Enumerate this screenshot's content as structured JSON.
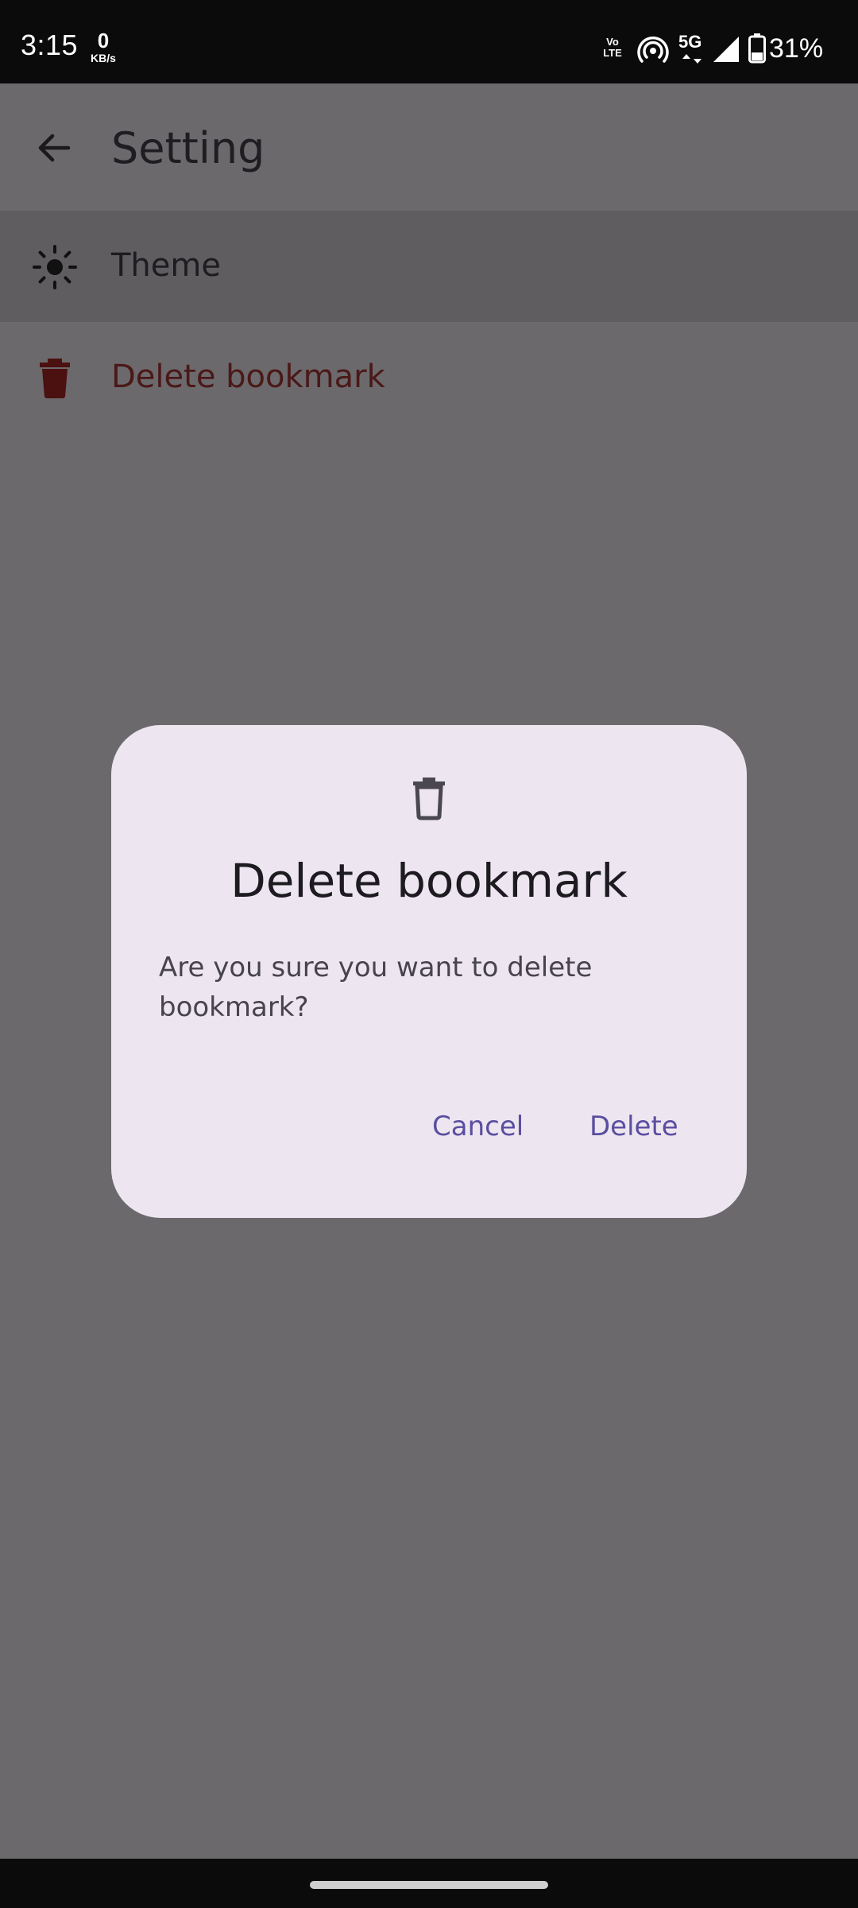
{
  "status_bar": {
    "time": "3:15",
    "net_speed_value": "0",
    "net_speed_unit": "KB/s",
    "volte_line1": "Vo",
    "volte_line2": "LTE",
    "network": "5G",
    "battery_percent": "31%",
    "icons": [
      "volte-icon",
      "hotspot-icon",
      "5g-icon",
      "signal-icon",
      "battery-icon"
    ]
  },
  "app_bar": {
    "title": "Setting",
    "back_icon": "arrow-left-icon"
  },
  "settings": {
    "items": [
      {
        "label": "Theme",
        "icon": "sun-icon"
      },
      {
        "label": "Delete bookmark",
        "icon": "trash-icon"
      }
    ]
  },
  "dialog": {
    "icon": "trash-outline-icon",
    "title": "Delete bookmark",
    "message": "Are you sure you want to delete bookmark?",
    "cancel_label": "Cancel",
    "confirm_label": "Delete"
  },
  "colors": {
    "scrim_background": "#6b696c",
    "dialog_surface": "#ede6f0",
    "dialog_button_text": "#5a4ea0",
    "delete_item_text": "#4b1818"
  }
}
